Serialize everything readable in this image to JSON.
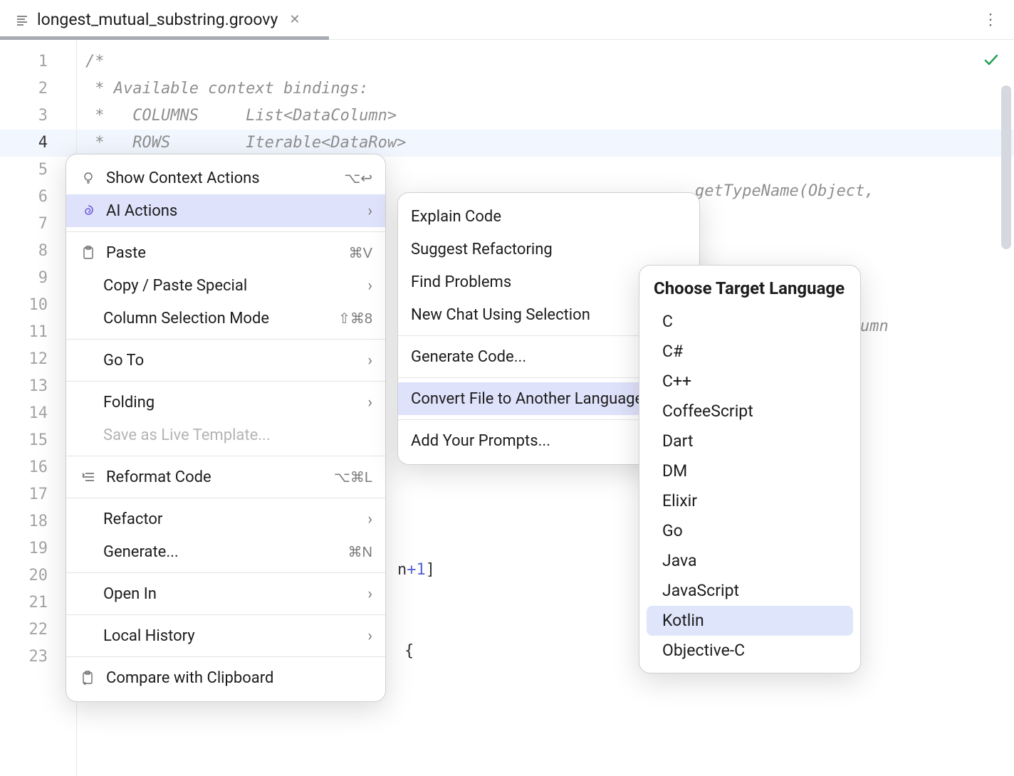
{
  "tab": {
    "filename": "longest_mutual_substring.groovy"
  },
  "gutter_lines": [
    "1",
    "2",
    "3",
    "4",
    "5",
    "6",
    "7",
    "8",
    "9",
    "10",
    "11",
    "12",
    "13",
    "14",
    "15",
    "16",
    "17",
    "18",
    "19",
    "20",
    "21",
    "22",
    "23"
  ],
  "current_line": "4",
  "code": {
    "l1": "/*",
    "l2": " * Available context bindings:",
    "l3": " *   COLUMNS     List<DataColumn>",
    "l4": " *   ROWS        Iterable<DataRow>",
    "l6_tail": "getTypeName(Object,",
    "l11_tail": "umn",
    "l20_tail": "n+1]",
    "l23_tail": "{"
  },
  "context_menu": {
    "show_context_actions": {
      "label": "Show Context Actions",
      "shortcut": "⌥↩"
    },
    "ai_actions": {
      "label": "AI Actions"
    },
    "paste": {
      "label": "Paste",
      "shortcut": "⌘V"
    },
    "copy_paste_special": {
      "label": "Copy / Paste Special"
    },
    "column_selection": {
      "label": "Column Selection Mode",
      "shortcut": "⇧⌘8"
    },
    "go_to": {
      "label": "Go To"
    },
    "folding": {
      "label": "Folding"
    },
    "save_live_template": {
      "label": "Save as Live Template..."
    },
    "reformat_code": {
      "label": "Reformat Code",
      "shortcut": "⌥⌘L"
    },
    "refactor": {
      "label": "Refactor"
    },
    "generate": {
      "label": "Generate...",
      "shortcut": "⌘N"
    },
    "open_in": {
      "label": "Open In"
    },
    "local_history": {
      "label": "Local History"
    },
    "compare_clipboard": {
      "label": "Compare with Clipboard"
    }
  },
  "ai_submenu": {
    "explain": "Explain Code",
    "suggest": "Suggest Refactoring",
    "find_problems": "Find Problems",
    "new_chat": "New Chat Using Selection",
    "generate": "Generate Code...",
    "convert": "Convert File to Another Language",
    "add_prompts": "Add Your Prompts..."
  },
  "language_popup": {
    "title": "Choose Target Language",
    "languages": [
      "C",
      "C#",
      "C++",
      "CoffeeScript",
      "Dart",
      "DM",
      "Elixir",
      "Go",
      "Java",
      "JavaScript",
      "Kotlin",
      "Objective-C"
    ],
    "highlighted": "Kotlin"
  }
}
